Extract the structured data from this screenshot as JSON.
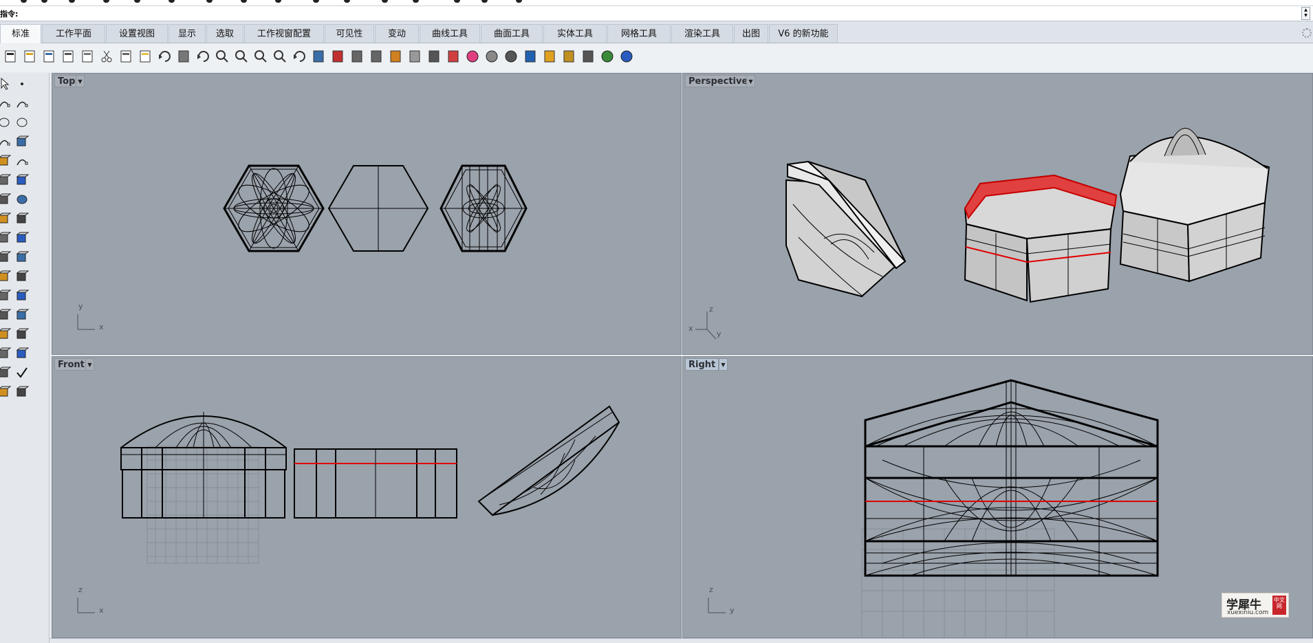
{
  "command": {
    "label": "指令:",
    "value": ""
  },
  "tabs": [
    {
      "label": "标准",
      "active": true
    },
    {
      "label": "工作平面"
    },
    {
      "label": "设置视图"
    },
    {
      "label": "显示"
    },
    {
      "label": "选取"
    },
    {
      "label": "工作视窗配置"
    },
    {
      "label": "可见性"
    },
    {
      "label": "变动"
    },
    {
      "label": "曲线工具"
    },
    {
      "label": "曲面工具"
    },
    {
      "label": "实体工具"
    },
    {
      "label": "网格工具"
    },
    {
      "label": "渲染工具"
    },
    {
      "label": "出图"
    },
    {
      "label": "V6 的新功能"
    }
  ],
  "toolbar_icons": [
    "new-icon",
    "open-icon",
    "save-icon",
    "print-icon",
    "import-icon",
    "cut-icon",
    "copy-icon",
    "paste-icon",
    "undo-icon",
    "pan-icon",
    "rotate-icon",
    "zoom-icon",
    "zoom-window-icon",
    "zoom-extents-icon",
    "zoom-selected-icon",
    "undo-view-icon",
    "four-viewports-icon",
    "car-icon",
    "hide-icon",
    "show-icon",
    "select-points-icon",
    "light-icon",
    "lock-icon",
    "layer-icon",
    "color-wheel-icon",
    "shaded-sphere-icon",
    "rendered-sphere-icon",
    "render-icon",
    "material-icon",
    "gear-icon",
    "mesh-icon",
    "globe-icon",
    "help-icon"
  ],
  "left_tools": [
    "select-arrow-icon",
    "point-icon",
    "polyline-icon",
    "curve-icon",
    "circle-icon",
    "ellipse-icon",
    "arc-icon",
    "rectangle-icon",
    "polygon-icon",
    "fillet-icon",
    "surface-icon",
    "loft-icon",
    "box-icon",
    "sphere-icon",
    "cylinder-icon",
    "extrude-icon",
    "boolean-icon",
    "shell-icon",
    "mesh-tool-icon",
    "dimension-icon",
    "join-icon",
    "explode-icon",
    "trim-icon",
    "split-icon",
    "array-icon",
    "move-icon",
    "group-icon",
    "transform-icon",
    "grid-array-icon",
    "block-icon",
    "analyze-icon",
    "check-icon",
    "render-tool-icon",
    "paint-icon"
  ],
  "viewports": {
    "top": {
      "title": "Top",
      "axis_h": "x",
      "axis_v": "y"
    },
    "perspective": {
      "title": "Perspective",
      "axis_h": "x",
      "axis_v": "z",
      "axis_d": "y"
    },
    "front": {
      "title": "Front",
      "axis_h": "x",
      "axis_v": "z"
    },
    "right": {
      "title": "Right",
      "axis_h": "y",
      "axis_v": "z"
    }
  },
  "watermark": {
    "cn": "学犀牛",
    "en": "xuexiniu.com",
    "seal": "中文网"
  },
  "colors": {
    "viewport_bg": "#9aa2ab",
    "selection": "#e00000",
    "wire": "#000000"
  }
}
